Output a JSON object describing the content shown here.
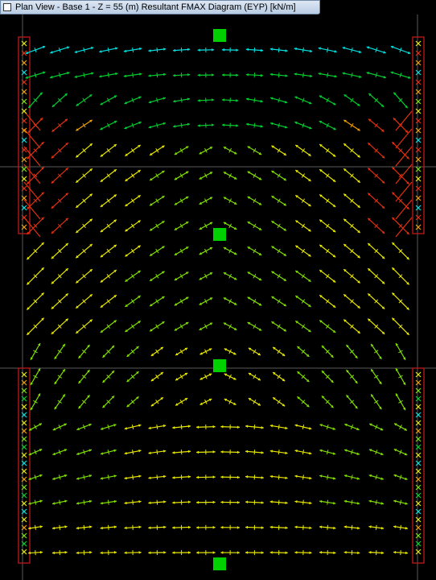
{
  "window": {
    "title": "Plan View - Base 1 - Z = 55 (m)    Resultant FMAX Diagram    (EYP)  [kN/m]"
  },
  "colors": {
    "background": "#000000",
    "grid_line": "#5a5a5a",
    "support": "#00d000",
    "wall_outline": "#c01818",
    "magnitude_scale": [
      "#00e0e0",
      "#00d030",
      "#80e000",
      "#e8e800",
      "#f0a000",
      "#e03010"
    ]
  },
  "icons": {
    "window": "window-icon",
    "support": "support-square-icon",
    "force_arrow": "double-headed-arrow-icon"
  }
}
